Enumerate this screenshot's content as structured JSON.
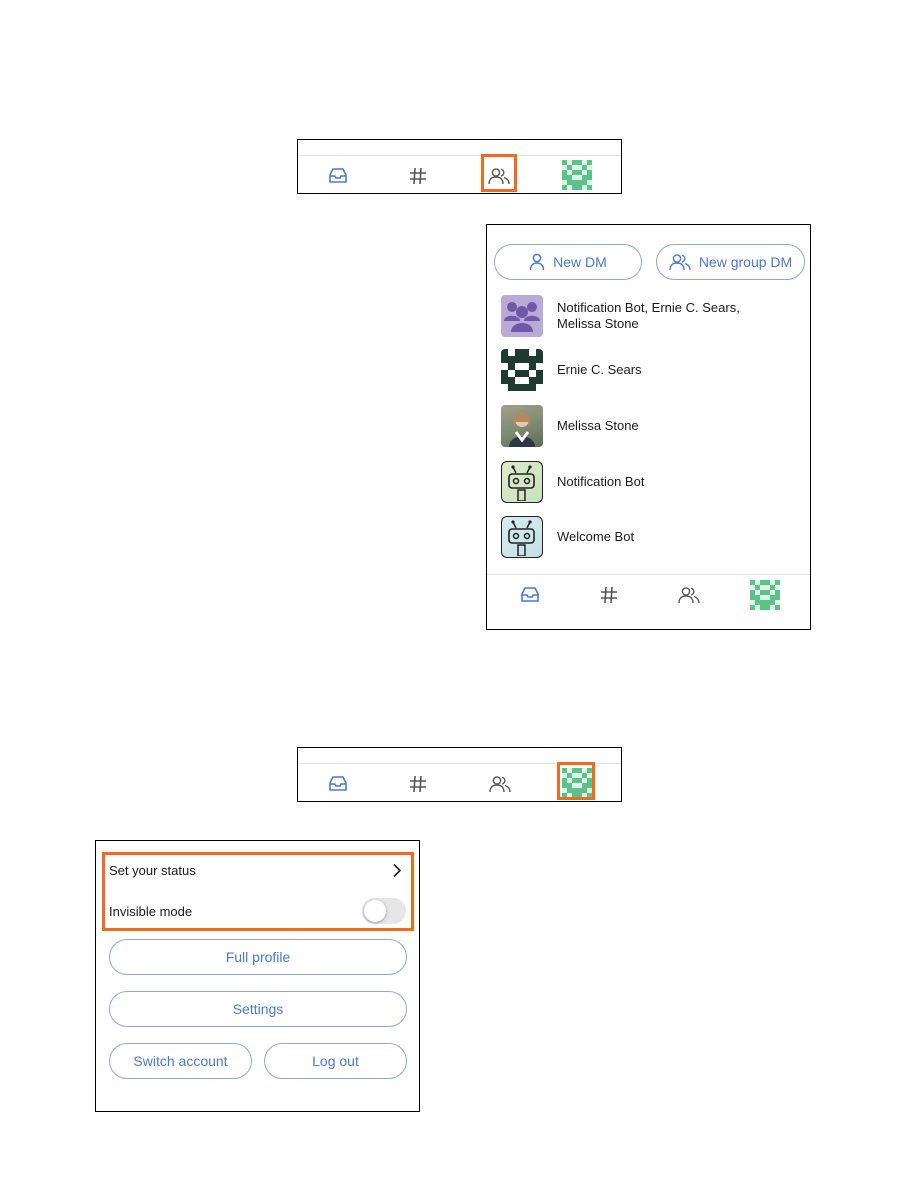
{
  "dm_panel": {
    "new_dm_label": "New DM",
    "new_group_dm_label": "New group DM",
    "conversations": [
      {
        "name": "Notification Bot, Ernie C. Sears, Melissa Stone",
        "avatar": "group-avatar"
      },
      {
        "name": "Ernie C. Sears",
        "avatar": "identicon-avatar"
      },
      {
        "name": "Melissa Stone",
        "avatar": "photo-avatar"
      },
      {
        "name": "Notification Bot",
        "avatar": "bot-avatar"
      },
      {
        "name": "Welcome Bot",
        "avatar": "bot-avatar"
      }
    ]
  },
  "tabbar": {
    "tabs": [
      "inbox-icon",
      "channels-hash-icon",
      "direct-messages-icon",
      "profile-avatar-icon"
    ],
    "highlighted_top": "direct-messages-icon",
    "highlighted_bottom": "profile-avatar-icon"
  },
  "profile_menu": {
    "set_status_label": "Set your status",
    "invisible_mode_label": "Invisible mode",
    "invisible_mode_on": false,
    "full_profile_label": "Full profile",
    "settings_label": "Settings",
    "switch_account_label": "Switch account",
    "log_out_label": "Log out"
  },
  "colors": {
    "accent": "#4a78d4",
    "highlight": "#f26a1b",
    "tab_icon_active": "#4a78d4",
    "tab_icon": "#555555",
    "identicon_green": "#5cc28a",
    "identicon_dark": "#1f3a30"
  }
}
